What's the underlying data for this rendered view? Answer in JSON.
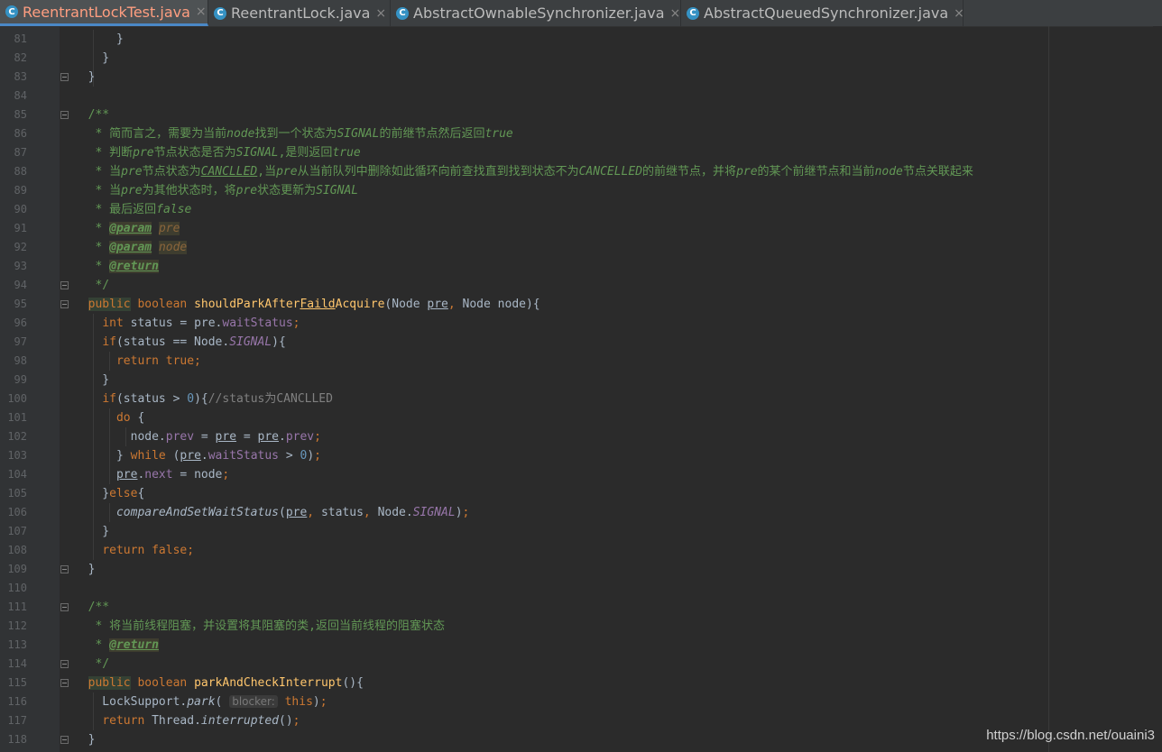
{
  "tabs": [
    {
      "label": "ReentrantLockTest.java",
      "active": true
    },
    {
      "label": "ReentrantLock.java",
      "active": false
    },
    {
      "label": "AbstractOwnableSynchronizer.java",
      "active": false
    },
    {
      "label": "AbstractQueuedSynchronizer.java",
      "active": false
    }
  ],
  "icons": {
    "class_icon": "C",
    "tab_close": "×"
  },
  "lines": [
    {
      "n": "81",
      "t": "        }"
    },
    {
      "n": "82",
      "t": "      }"
    },
    {
      "n": "83",
      "t": "  }"
    },
    {
      "n": "84",
      "t": ""
    },
    {
      "n": "85",
      "t": "  /**"
    },
    {
      "n": "86",
      "t": "   * 简而言之，需要为当前node找到一个状态为SIGNAL的前继节点然后返回true"
    },
    {
      "n": "87",
      "t": "   * 判断pre节点状态是否为SIGNAL,是则返回true"
    },
    {
      "n": "88",
      "t": "   * 当pre节点状态为CANCLLED,当pre从当前队列中删除如此循环向前查找直到找到状态不为CANCELLED的前继节点，并将pre的某个前继节点和当前node节点关联起来"
    },
    {
      "n": "89",
      "t": "   * 当pre为其他状态时，将pre状态更新为SIGNAL"
    },
    {
      "n": "90",
      "t": "   * 最后返回false"
    },
    {
      "n": "91",
      "t": "   * @param pre"
    },
    {
      "n": "92",
      "t": "   * @param node"
    },
    {
      "n": "93",
      "t": "   * @return"
    },
    {
      "n": "94",
      "t": "   */"
    },
    {
      "n": "95",
      "t": "  public boolean shouldParkAfterFaildAcquire(Node pre, Node node){"
    },
    {
      "n": "96",
      "t": "    int status = pre.waitStatus;"
    },
    {
      "n": "97",
      "t": "    if(status == Node.SIGNAL){"
    },
    {
      "n": "98",
      "t": "      return true;"
    },
    {
      "n": "99",
      "t": "    }"
    },
    {
      "n": "100",
      "t": "    if(status > 0){//status为CANCLLED"
    },
    {
      "n": "101",
      "t": "      do {"
    },
    {
      "n": "102",
      "t": "        node.prev = pre = pre.prev;"
    },
    {
      "n": "103",
      "t": "      } while (pre.waitStatus > 0);"
    },
    {
      "n": "104",
      "t": "      pre.next = node;"
    },
    {
      "n": "105",
      "t": "    }else{"
    },
    {
      "n": "106",
      "t": "      compareAndSetWaitStatus(pre, status, Node.SIGNAL);"
    },
    {
      "n": "107",
      "t": "    }"
    },
    {
      "n": "108",
      "t": "    return false;"
    },
    {
      "n": "109",
      "t": "  }"
    },
    {
      "n": "110",
      "t": ""
    },
    {
      "n": "111",
      "t": "  /**"
    },
    {
      "n": "112",
      "t": "   * 将当前线程阻塞，并设置将其阻塞的类,返回当前线程的阻塞状态"
    },
    {
      "n": "113",
      "t": "   * @return"
    },
    {
      "n": "114",
      "t": "   */"
    },
    {
      "n": "115",
      "t": "  public boolean parkAndCheckInterrupt(){"
    },
    {
      "n": "116",
      "t": "    LockSupport.park( blocker: this);"
    },
    {
      "n": "117",
      "t": "    return Thread.interrupted();"
    },
    {
      "n": "118",
      "t": "  }"
    }
  ],
  "watermark": "https://blog.csdn.net/ouaini3"
}
